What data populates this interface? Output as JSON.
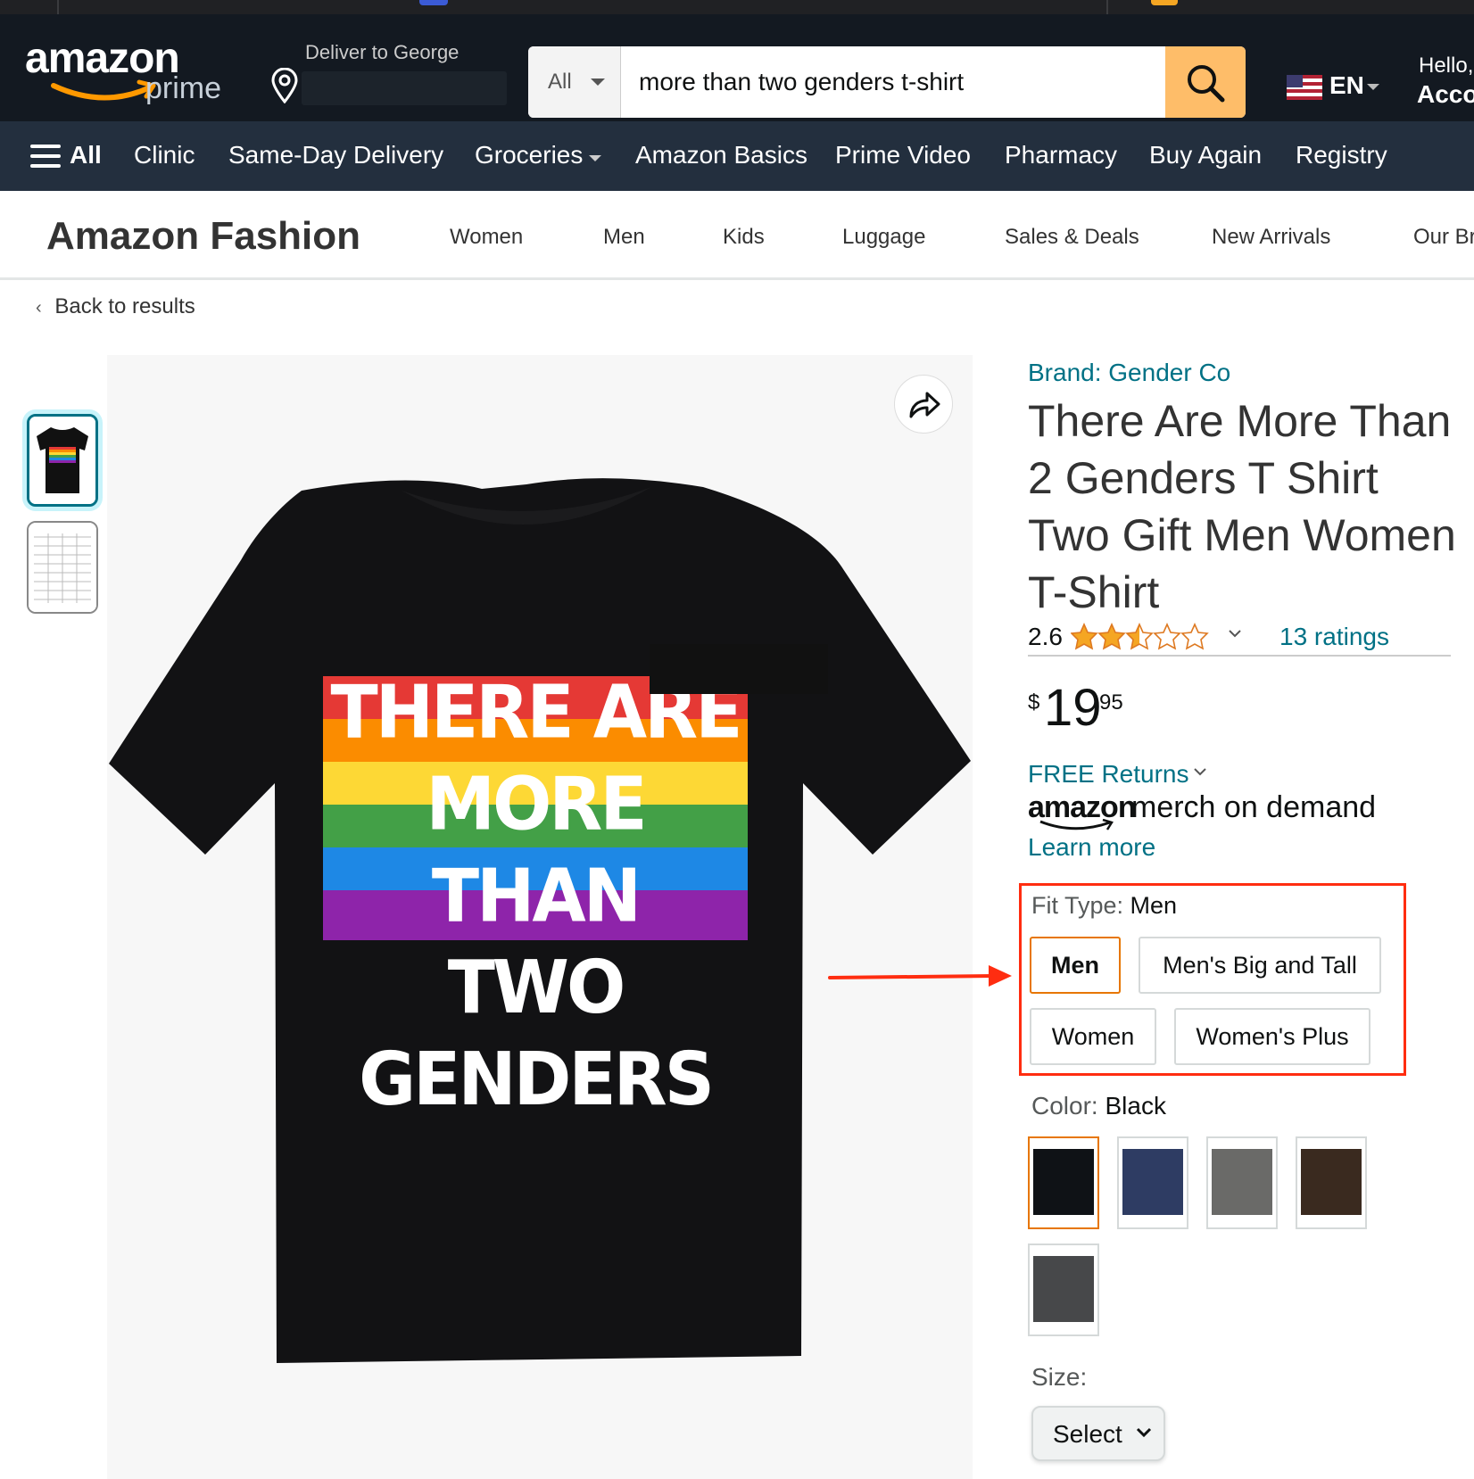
{
  "header": {
    "logo_text": "amazon",
    "logo_sub": "prime",
    "deliver_label": "Deliver to George",
    "search": {
      "category": "All",
      "query": "more than two genders t-shirt"
    },
    "language": "EN",
    "greeting": "Hello,",
    "account_label": "Acco"
  },
  "subnav": {
    "all_label": "All",
    "items": [
      "Clinic",
      "Same-Day Delivery",
      "Groceries",
      "Amazon Basics",
      "Prime Video",
      "Pharmacy",
      "Buy Again",
      "Registry"
    ]
  },
  "fashion": {
    "title": "Amazon Fashion",
    "links": [
      "Women",
      "Men",
      "Kids",
      "Luggage",
      "Sales & Deals",
      "New Arrivals",
      "Our Br"
    ]
  },
  "back_link": "Back to results",
  "product": {
    "brand": "Brand: Gender Co",
    "title": "There Are More Than 2 Genders T Shirt Two Gift Men Women T-Shirt",
    "rating_value": "2.6",
    "rating_stars": 2.5,
    "ratings_count": "13 ratings",
    "price": {
      "symbol": "$",
      "whole": "19",
      "fraction": "95"
    },
    "free_returns": "FREE Returns",
    "merch_logo": "amazon",
    "merch_text": "merch on demand",
    "learn_more": "Learn more",
    "fit_type": {
      "label": "Fit Type: ",
      "selected": "Men",
      "options": [
        "Men",
        "Men's Big and Tall",
        "Women",
        "Women's Plus"
      ]
    },
    "color": {
      "label": "Color: ",
      "selected": "Black",
      "swatches": [
        "#0f1216",
        "#2e3c63",
        "#6a6a68",
        "#3a2a1f",
        "#47484a"
      ]
    },
    "size": {
      "label": "Size:",
      "select_label": "Select"
    },
    "shirt_print": [
      "THERE ARE",
      "MORE THAN",
      "TWO GENDERS"
    ]
  },
  "colors": {
    "nav_bg": "#131921",
    "subnav_bg": "#232f3e",
    "search_button": "#febd69",
    "link": "#007185",
    "selected_outline": "#e77600",
    "annotation_red": "#ff2d10",
    "star": "#f5a623"
  },
  "icons": [
    "location-pin-icon",
    "search-icon",
    "us-flag-icon",
    "hamburger-icon",
    "share-icon",
    "chevron-down-icon",
    "star-icon"
  ]
}
